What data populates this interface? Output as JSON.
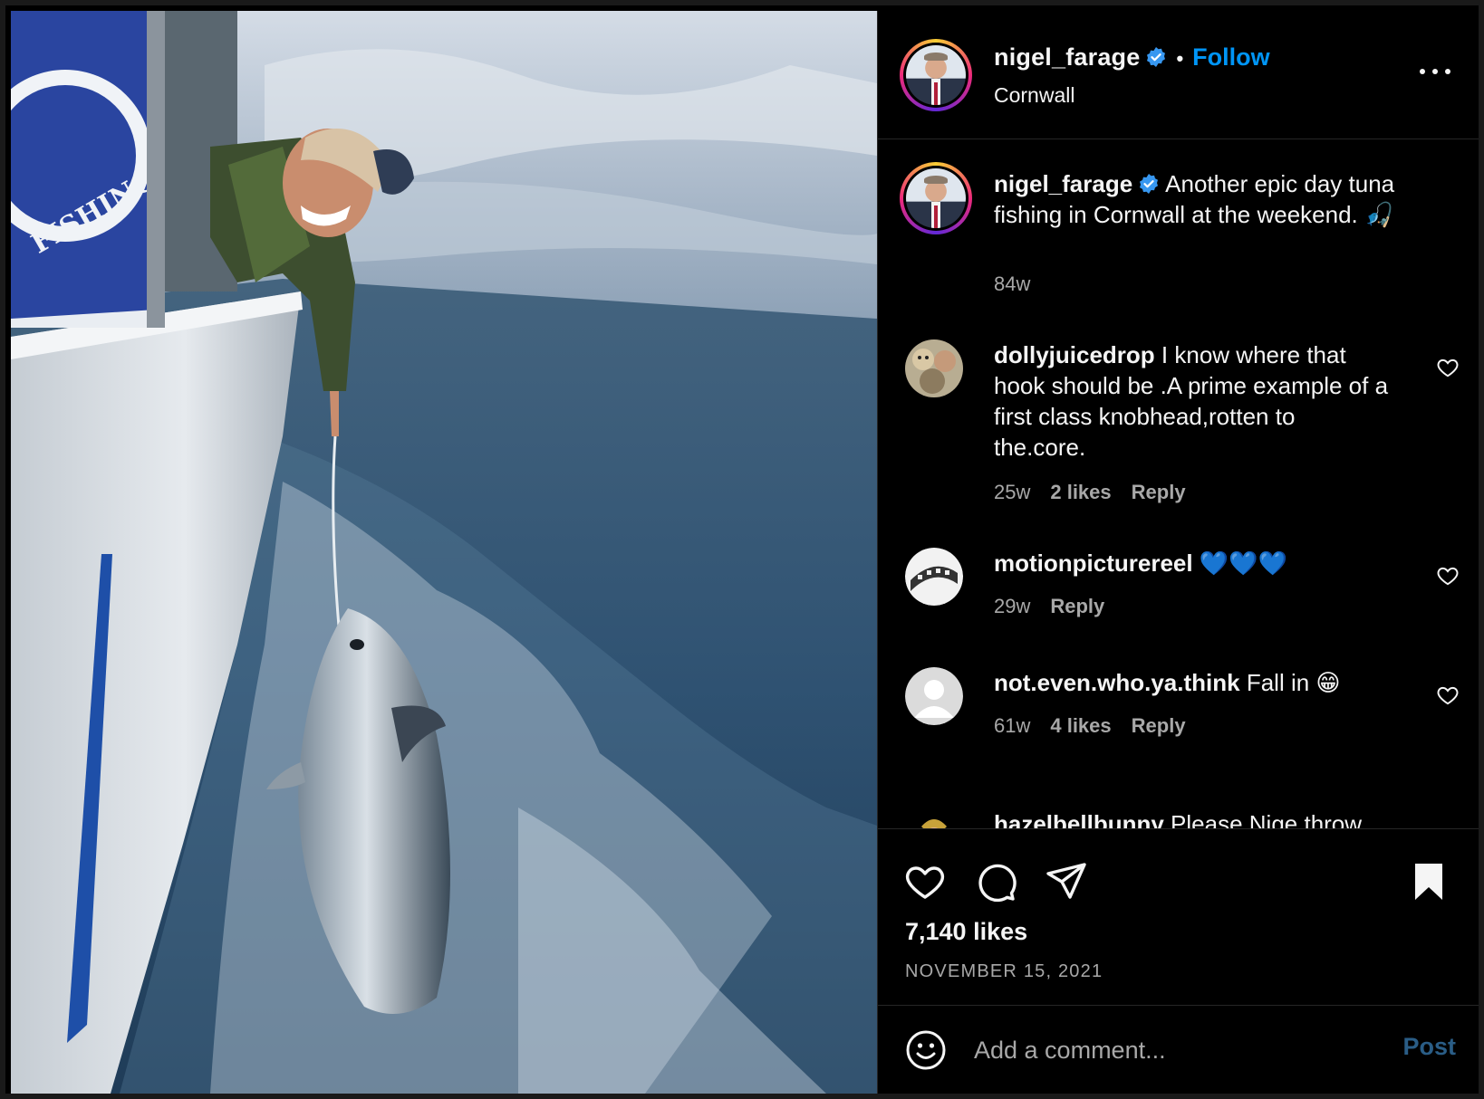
{
  "post": {
    "author": "nigel_farage",
    "follow_label": "Follow",
    "separator": "•",
    "location": "Cornwall",
    "caption": "Another epic day tuna fishing in Cornwall at the weekend. 🎣",
    "caption_age": "84w",
    "likes": "7,140 likes",
    "date": "NOVEMBER 15, 2021",
    "image_banner_text": "FISHING"
  },
  "comments": [
    {
      "username": "dollyjuicedrop",
      "text": "I know where that hook should be .A prime example of a first class knobhead,rotten to the.core.",
      "age": "25w",
      "likes": "2 likes",
      "reply": "Reply"
    },
    {
      "username": "motionpicturereel",
      "text": "💙💙💙",
      "age": "29w",
      "reply": "Reply"
    },
    {
      "username": "not.even.who.ya.think",
      "text": "Fall in 😁",
      "age": "61w",
      "likes": "4 likes",
      "reply": "Reply"
    },
    {
      "username": "hazelbellbunny",
      "text": "Please Nige throw"
    }
  ],
  "composer": {
    "placeholder": "Add a comment...",
    "post_label": "Post"
  },
  "icons": {
    "verified": "verified-badge-icon",
    "more": "more-options-icon",
    "like": "heart-icon",
    "comment": "comment-bubble-icon",
    "share": "paper-plane-icon",
    "save": "bookmark-filled-icon",
    "emoji": "emoji-smile-icon"
  },
  "colors": {
    "background": "#000000",
    "accent": "#0095f6",
    "text": "#f5f5f5",
    "muted": "#a8a8a8",
    "divider": "#262626",
    "post_disabled": "#2a5d86",
    "verified": "#3797f0"
  }
}
